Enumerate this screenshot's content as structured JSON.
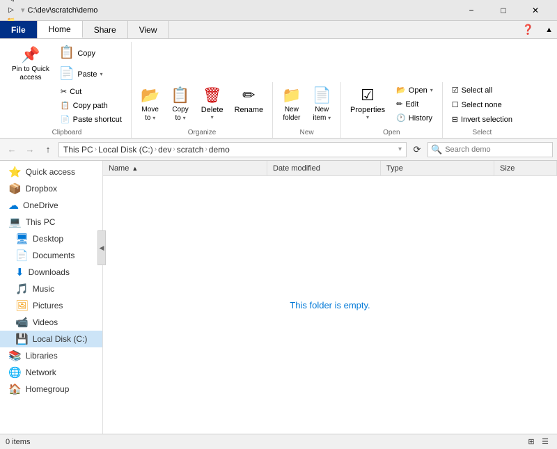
{
  "titlebar": {
    "path": "C:\\dev\\scratch\\demo",
    "min_label": "−",
    "max_label": "□",
    "close_label": "✕"
  },
  "tabs": [
    {
      "id": "file",
      "label": "File"
    },
    {
      "id": "home",
      "label": "Home"
    },
    {
      "id": "share",
      "label": "Share"
    },
    {
      "id": "view",
      "label": "View"
    }
  ],
  "ribbon": {
    "groups": {
      "clipboard": {
        "label": "Clipboard",
        "pin_label": "Pin to Quick\naccess",
        "copy_label": "Copy",
        "paste_label": "Paste",
        "cut_label": "Cut",
        "copy_path_label": "Copy path",
        "paste_shortcut_label": "Paste shortcut"
      },
      "organize": {
        "label": "Organize",
        "move_label": "Move\nto",
        "copy_label": "Copy\nto",
        "delete_label": "Delete",
        "rename_label": "Rename"
      },
      "new": {
        "label": "New",
        "new_folder_label": "New\nfolder"
      },
      "open": {
        "label": "Open",
        "properties_label": "Properties",
        "open_label": "Open",
        "edit_label": "Edit",
        "history_label": "History"
      },
      "select": {
        "label": "Select",
        "select_all_label": "Select all",
        "select_none_label": "Select none",
        "invert_label": "Invert selection"
      }
    }
  },
  "addressbar": {
    "back_label": "←",
    "forward_label": "→",
    "up_label": "↑",
    "breadcrumb": [
      {
        "label": "This PC"
      },
      {
        "label": "Local Disk (C:)"
      },
      {
        "label": "dev"
      },
      {
        "label": "scratch"
      },
      {
        "label": "demo"
      }
    ],
    "search_placeholder": "Search demo",
    "refresh_label": "⟳"
  },
  "sidebar": {
    "items": [
      {
        "id": "quick-access",
        "icon": "⭐",
        "label": "Quick access"
      },
      {
        "id": "dropbox",
        "icon": "📦",
        "label": "Dropbox"
      },
      {
        "id": "onedrive",
        "icon": "☁",
        "label": "OneDrive"
      },
      {
        "id": "this-pc",
        "icon": "💻",
        "label": "This PC"
      },
      {
        "id": "desktop",
        "icon": "🖥",
        "label": "Desktop"
      },
      {
        "id": "documents",
        "icon": "📄",
        "label": "Documents"
      },
      {
        "id": "downloads",
        "icon": "⬇",
        "label": "Downloads"
      },
      {
        "id": "music",
        "icon": "🎵",
        "label": "Music"
      },
      {
        "id": "pictures",
        "icon": "🖼",
        "label": "Pictures"
      },
      {
        "id": "videos",
        "icon": "📹",
        "label": "Videos"
      },
      {
        "id": "local-disk",
        "icon": "💾",
        "label": "Local Disk (C:)"
      },
      {
        "id": "libraries",
        "icon": "📚",
        "label": "Libraries"
      },
      {
        "id": "network",
        "icon": "🌐",
        "label": "Network"
      },
      {
        "id": "homegroup",
        "icon": "🏠",
        "label": "Homegroup"
      }
    ]
  },
  "filelist": {
    "columns": [
      {
        "id": "name",
        "label": "Name"
      },
      {
        "id": "date",
        "label": "Date modified"
      },
      {
        "id": "type",
        "label": "Type"
      },
      {
        "id": "size",
        "label": "Size"
      }
    ],
    "empty_message": "This folder is empty."
  },
  "statusbar": {
    "items_label": "0 items",
    "view_icons": [
      "⊞",
      "☰"
    ]
  }
}
